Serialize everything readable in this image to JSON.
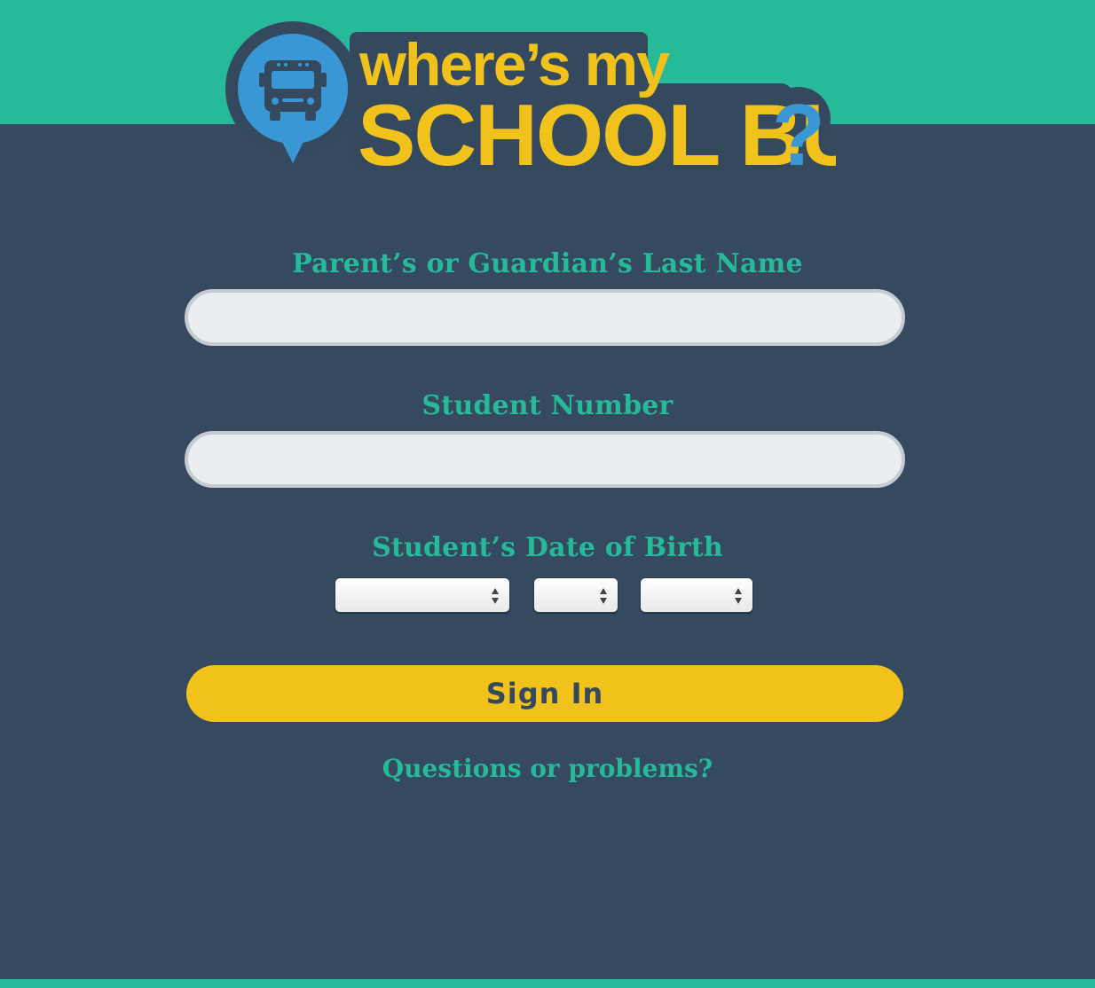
{
  "logo": {
    "line1": "where’s my",
    "line2": "SCHOOL BUS",
    "question_mark": "?",
    "icon": "school-bus-icon",
    "colors": {
      "yellow": "#f0c21b",
      "blue": "#3a97d6",
      "outline": "#34495e"
    }
  },
  "form": {
    "last_name": {
      "label": "Parent’s or Guardian’s Last Name",
      "value": "",
      "placeholder": ""
    },
    "student_number": {
      "label": "Student Number",
      "value": "",
      "placeholder": ""
    },
    "dob": {
      "label": "Student’s Date of Birth",
      "month": {
        "selected": ""
      },
      "day": {
        "selected": ""
      },
      "year": {
        "selected": ""
      }
    },
    "submit_label": "Sign In",
    "help_link": "Questions or problems?"
  },
  "colors": {
    "background": "#354a5f",
    "accent": "#26b99a",
    "button": "#f0c21b",
    "input_bg": "#ebeef0",
    "input_border": "#c4cbd2"
  }
}
